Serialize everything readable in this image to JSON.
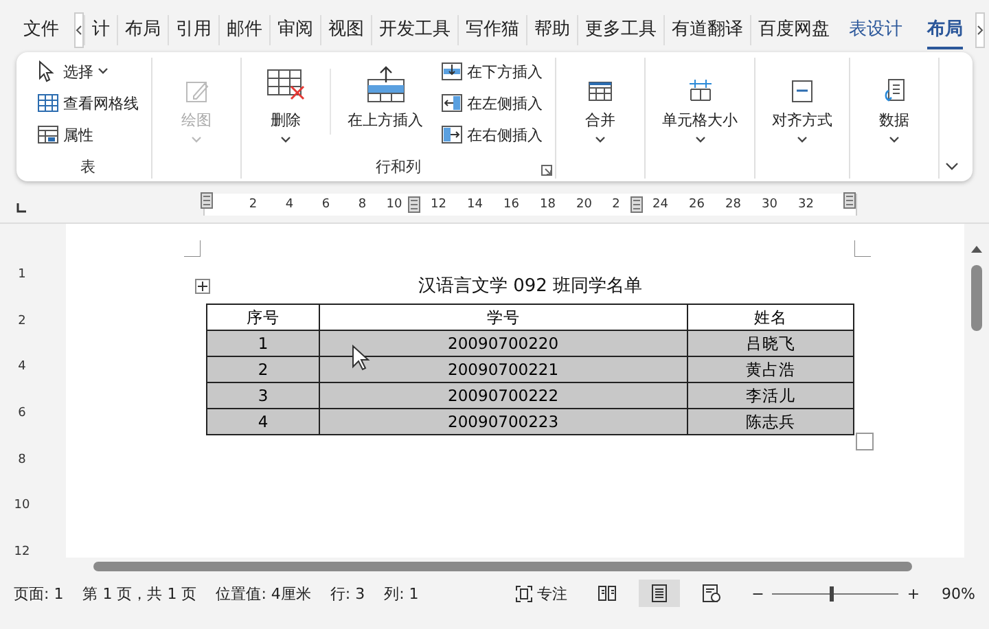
{
  "tabs": [
    {
      "label": "文件",
      "selected": false,
      "contextual": false
    },
    {
      "label": "计",
      "selected": false,
      "contextual": false
    },
    {
      "label": "布局",
      "selected": false,
      "contextual": false
    },
    {
      "label": "引用",
      "selected": false,
      "contextual": false
    },
    {
      "label": "邮件",
      "selected": false,
      "contextual": false
    },
    {
      "label": "审阅",
      "selected": false,
      "contextual": false
    },
    {
      "label": "视图",
      "selected": false,
      "contextual": false
    },
    {
      "label": "开发工具",
      "selected": false,
      "contextual": false
    },
    {
      "label": "写作猫",
      "selected": false,
      "contextual": false
    },
    {
      "label": "帮助",
      "selected": false,
      "contextual": false
    },
    {
      "label": "更多工具",
      "selected": false,
      "contextual": false
    },
    {
      "label": "有道翻译",
      "selected": false,
      "contextual": false
    },
    {
      "label": "百度网盘",
      "selected": false,
      "contextual": false
    },
    {
      "label": "表设计",
      "selected": false,
      "contextual": true
    },
    {
      "label": "布局",
      "selected": true,
      "contextual": true
    }
  ],
  "ribbon": {
    "groups": [
      {
        "label": "表",
        "items": [
          {
            "kind": "small",
            "label": "选择",
            "dropdown": true,
            "disabled": false
          },
          {
            "kind": "small",
            "label": "查看网格线",
            "dropdown": false,
            "disabled": false
          },
          {
            "kind": "small",
            "label": "属性",
            "dropdown": false,
            "disabled": false
          }
        ]
      },
      {
        "items": [
          {
            "kind": "large",
            "label": "绘图",
            "dropdown": true,
            "disabled": true
          }
        ]
      },
      {
        "label": "行和列",
        "launcher": true,
        "items": [
          {
            "kind": "large",
            "label": "删除",
            "dropdown": true,
            "disabled": false
          },
          {
            "kind": "large",
            "label": "在上方插入",
            "dropdown": false,
            "disabled": false
          },
          {
            "kind": "small",
            "label": "在下方插入",
            "dropdown": false,
            "disabled": false
          },
          {
            "kind": "small",
            "label": "在左侧插入",
            "dropdown": false,
            "disabled": false
          },
          {
            "kind": "small",
            "label": "在右侧插入",
            "dropdown": false,
            "disabled": false
          }
        ]
      },
      {
        "items": [
          {
            "kind": "large",
            "label": "合并",
            "dropdown": true,
            "disabled": false
          }
        ]
      },
      {
        "items": [
          {
            "kind": "large",
            "label": "单元格大小",
            "dropdown": true,
            "disabled": false
          }
        ]
      },
      {
        "items": [
          {
            "kind": "large",
            "label": "对齐方式",
            "dropdown": true,
            "disabled": false
          }
        ]
      },
      {
        "items": [
          {
            "kind": "large",
            "label": "数据",
            "dropdown": true,
            "disabled": false
          }
        ]
      }
    ]
  },
  "ruler": {
    "ticks": [
      "2",
      "4",
      "6",
      "8",
      "10",
      "12",
      "14",
      "16",
      "18",
      "20",
      "2",
      "24",
      "26",
      "28",
      "30",
      "32"
    ]
  },
  "vertical_ruler": {
    "ticks": [
      "1",
      "2",
      "4",
      "6",
      "8",
      "10",
      "12"
    ]
  },
  "document": {
    "title": "汉语言文学 092 班同学名单",
    "table": {
      "columns": [
        "序号",
        "学号",
        "姓名"
      ],
      "rows": [
        {
          "cells": [
            "1",
            "20090700220",
            "吕晓飞"
          ],
          "selected": true
        },
        {
          "cells": [
            "2",
            "20090700221",
            "黄占浩"
          ],
          "selected": true
        },
        {
          "cells": [
            "3",
            "20090700222",
            "李活儿"
          ],
          "selected": true
        },
        {
          "cells": [
            "4",
            "20090700223",
            "陈志兵"
          ],
          "selected": true
        }
      ]
    }
  },
  "status_bar": {
    "items": [
      "页面: 1",
      "第 1 页，共 1 页",
      "位置值: 4厘米",
      "行: 3",
      "列: 1"
    ],
    "focus": "专注",
    "views": [
      {
        "selected": false
      },
      {
        "selected": true
      },
      {
        "selected": false
      }
    ],
    "zoom": {
      "minus": "−",
      "plus": "+",
      "level": 0.45,
      "reading": "90%"
    }
  }
}
